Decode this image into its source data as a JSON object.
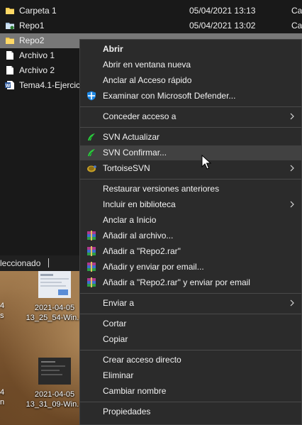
{
  "explorer": {
    "files": [
      {
        "name": "Carpeta 1",
        "date": "05/04/2021 13:13",
        "type": "Ca",
        "icon": "folder-icon"
      },
      {
        "name": "Repo1",
        "date": "05/04/2021 13:02",
        "type": "Ca",
        "icon": "repo-folder-icon"
      },
      {
        "name": "Repo2",
        "date": "",
        "type": "",
        "icon": "folder-icon",
        "selected": true
      },
      {
        "name": "Archivo 1",
        "date": "",
        "type": "",
        "icon": "document-icon"
      },
      {
        "name": "Archivo 2",
        "date": "",
        "type": "",
        "icon": "document-icon"
      },
      {
        "name": "Tema4.1-Ejercic",
        "date": "",
        "type": "",
        "icon": "word-document-icon"
      }
    ]
  },
  "statusbar": {
    "text": "leccionado"
  },
  "desktop": {
    "icons": [
      {
        "line1": "2021-04-05",
        "line2": "13_25_54-Win..."
      },
      {
        "line1": "2021-04-05",
        "line2": "13_31_09-Win..."
      }
    ],
    "edge_fragments": [
      "4",
      "s",
      "4",
      "n"
    ]
  },
  "context_menu": {
    "items": [
      {
        "label": "Abrir",
        "bold": true
      },
      {
        "label": "Abrir en ventana nueva"
      },
      {
        "label": "Anclar al Acceso rápido"
      },
      {
        "label": "Examinar con Microsoft Defender...",
        "icon": "defender-shield-icon"
      },
      {
        "label": "Conceder acceso a",
        "submenu": true
      },
      {
        "label": "SVN Actualizar",
        "icon": "svn-update-icon"
      },
      {
        "label": "SVN Confirmar...",
        "icon": "svn-commit-icon",
        "hover": true
      },
      {
        "label": "TortoiseSVN",
        "icon": "tortoisesvn-icon",
        "submenu": true
      },
      {
        "label": "Restaurar versiones anteriores"
      },
      {
        "label": "Incluir en biblioteca",
        "submenu": true
      },
      {
        "label": "Anclar a Inicio"
      },
      {
        "label": "Añadir al archivo...",
        "icon": "winrar-icon"
      },
      {
        "label": "Añadir a \"Repo2.rar\"",
        "icon": "winrar-icon"
      },
      {
        "label": "Añadir y enviar por email...",
        "icon": "winrar-icon"
      },
      {
        "label": "Añadir a \"Repo2.rar\" y enviar por email",
        "icon": "winrar-icon"
      },
      {
        "label": "Enviar a",
        "submenu": true
      },
      {
        "label": "Cortar"
      },
      {
        "label": "Copiar"
      },
      {
        "label": "Crear acceso directo"
      },
      {
        "label": "Eliminar"
      },
      {
        "label": "Cambiar nombre"
      },
      {
        "label": "Propiedades"
      }
    ]
  },
  "colors": {
    "menu_bg": "#2b2b2b",
    "menu_hover": "#414141",
    "selected_row": "#777777",
    "folder": "#f2c94c",
    "svn_green": "#2ecc40"
  }
}
